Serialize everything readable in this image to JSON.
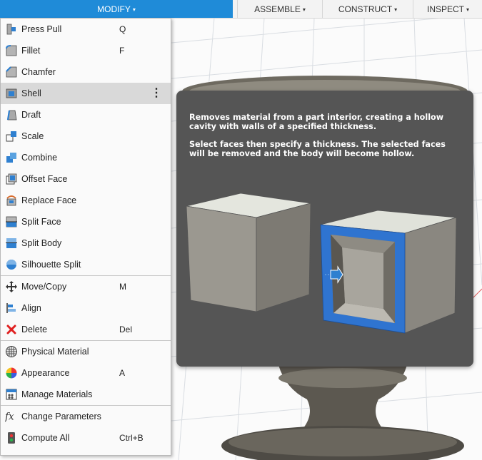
{
  "toolbar": {
    "tabs": [
      {
        "label": "MODIFY",
        "active": true
      },
      {
        "label": "ASSEMBLE",
        "active": false
      },
      {
        "label": "CONSTRUCT",
        "active": false
      },
      {
        "label": "INSPECT",
        "active": false
      }
    ],
    "caret": "▾"
  },
  "menu": {
    "items": [
      {
        "label": "Press Pull",
        "shortcut": "Q",
        "icon": "press-pull-icon"
      },
      {
        "label": "Fillet",
        "shortcut": "F",
        "icon": "fillet-icon"
      },
      {
        "label": "Chamfer",
        "shortcut": "",
        "icon": "chamfer-icon"
      },
      {
        "label": "Shell",
        "shortcut": "",
        "icon": "shell-icon",
        "hovered": true,
        "more": "⋮"
      },
      {
        "label": "Draft",
        "shortcut": "",
        "icon": "draft-icon"
      },
      {
        "label": "Scale",
        "shortcut": "",
        "icon": "scale-icon"
      },
      {
        "label": "Combine",
        "shortcut": "",
        "icon": "combine-icon"
      },
      {
        "label": "Offset Face",
        "shortcut": "",
        "icon": "offset-face-icon"
      },
      {
        "label": "Replace Face",
        "shortcut": "",
        "icon": "replace-face-icon"
      },
      {
        "label": "Split Face",
        "shortcut": "",
        "icon": "split-face-icon"
      },
      {
        "label": "Split Body",
        "shortcut": "",
        "icon": "split-body-icon"
      },
      {
        "label": "Silhouette Split",
        "shortcut": "",
        "icon": "silhouette-split-icon"
      },
      {
        "label": "Move/Copy",
        "shortcut": "M",
        "icon": "move-copy-icon"
      },
      {
        "label": "Align",
        "shortcut": "",
        "icon": "align-icon"
      },
      {
        "label": "Delete",
        "shortcut": "Del",
        "icon": "delete-icon"
      },
      {
        "label": "Physical Material",
        "shortcut": "",
        "icon": "physical-material-icon"
      },
      {
        "label": "Appearance",
        "shortcut": "A",
        "icon": "appearance-icon"
      },
      {
        "label": "Manage Materials",
        "shortcut": "",
        "icon": "manage-materials-icon"
      },
      {
        "label": "Change Parameters",
        "shortcut": "",
        "icon": "change-parameters-icon"
      },
      {
        "label": "Compute All",
        "shortcut": "Ctrl+B",
        "icon": "compute-all-icon"
      }
    ]
  },
  "tooltip": {
    "line1": "Removes material from a part interior, creating a hollow cavity with walls of a specified thickness.",
    "line2": "Select faces then specify a thickness. The selected faces will be removed and the body will become hollow."
  },
  "colors": {
    "accent": "#1f8bd8",
    "tooltip_bg": "#555555",
    "highlight_face": "#2f74d0"
  }
}
